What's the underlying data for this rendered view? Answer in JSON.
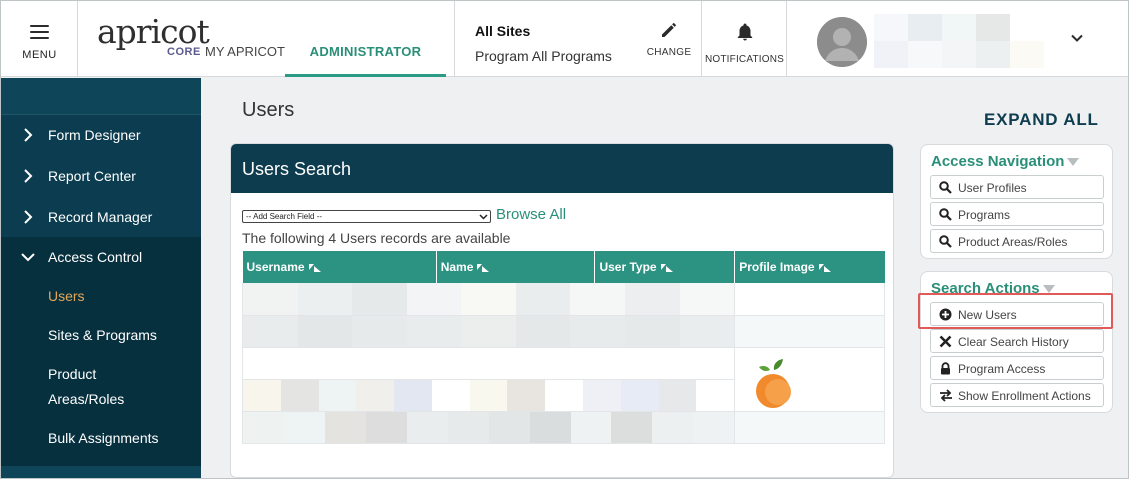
{
  "header": {
    "menu_label": "MENU",
    "logo_text": "apricot",
    "logo_sub": "CORE",
    "my_apricot": "MY APRICOT",
    "admin_tab": "ADMINISTRATOR",
    "sites_title": "All Sites",
    "sites_sub": "Program All Programs",
    "change_label": "CHANGE",
    "notifications_label": "NOTIFICATIONS"
  },
  "sidebar": {
    "items": [
      {
        "label": "Form Designer"
      },
      {
        "label": "Report Center"
      },
      {
        "label": "Record Manager"
      },
      {
        "label": "Access Control"
      }
    ],
    "sub_items": [
      {
        "label": "Users"
      },
      {
        "label": "Sites & Programs"
      },
      {
        "label": "Product"
      },
      {
        "label": "Areas/Roles"
      },
      {
        "label": "Bulk Assignments"
      }
    ]
  },
  "main": {
    "page_title": "Users",
    "expand_all": "EXPAND ALL",
    "search_panel_title": "Users Search",
    "add_search_field": "-- Add Search Field --",
    "browse_all": "Browse All",
    "records_message": "The following 4 Users records are available",
    "table_headers": [
      "Username",
      "Name",
      "User Type",
      "Profile Image"
    ]
  },
  "access_navigation": {
    "title": "Access Navigation",
    "buttons": [
      "User Profiles",
      "Programs",
      "Product Areas/Roles"
    ]
  },
  "search_actions": {
    "title": "Search Actions",
    "buttons": [
      "New Users",
      "Clear Search History",
      "Program Access",
      "Show Enrollment Actions"
    ]
  },
  "colors": {
    "accent": "#2a8f79",
    "sidebar_bg": "#0b3c4f",
    "active_sub": "#e3a75a",
    "highlight": "#e05a5a"
  }
}
